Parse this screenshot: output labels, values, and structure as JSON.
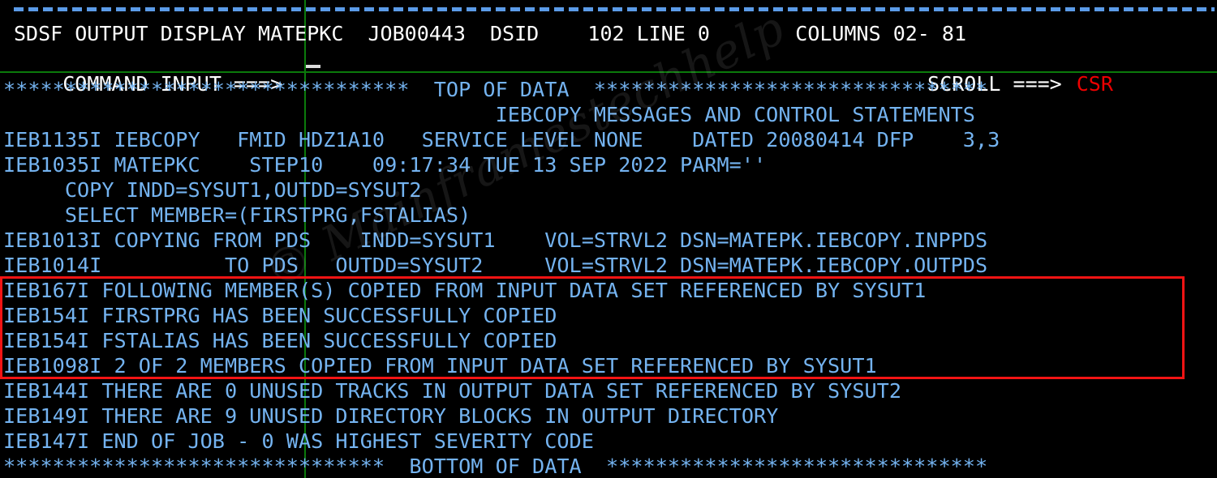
{
  "terminal": {
    "title": "SDSF OUTPUT DISPLAY",
    "background_color": "#000000",
    "header_text_color": "#ffffff",
    "body_text_color": "#74b3f0",
    "accent_red": "#ee0000",
    "highlight_box_color": "#f21414",
    "raster_line_color": "#0b7a0b",
    "dash_rule_color": "#5b9be8"
  },
  "watermark": {
    "text": "© Mainframestechhelp"
  },
  "header": {
    "line1": "SDSF OUTPUT DISPLAY MATEPKC  JOB00443  DSID    102 LINE 0       COLUMNS 02- 81",
    "line2_label": "COMMAND INPUT ===>",
    "line2_value": "",
    "scroll_label": "SCROLL ===>",
    "scroll_value": "CSR",
    "fields": {
      "panel": "SDSF OUTPUT DISPLAY",
      "jobname": "MATEPKC",
      "jobid": "JOB00443",
      "dsid_label": "DSID",
      "dsid": "102",
      "line_label": "LINE",
      "line": "0",
      "columns_label": "COLUMNS",
      "columns": "02- 81"
    }
  },
  "rows": [
    {
      "id": "top-of-data",
      "text": "*********************************  TOP OF DATA  ********************************"
    },
    {
      "id": "subtitle",
      "text": "                                        IEBCOPY MESSAGES AND CONTROL STATEMENTS"
    },
    {
      "id": "ieb1135i",
      "text": "IEB1135I IEBCOPY   FMID HDZ1A10   SERVICE LEVEL NONE    DATED 20080414 DFP    3,3"
    },
    {
      "id": "ieb1035i",
      "text": "IEB1035I MATEPKC    STEP10    09:17:34 TUE 13 SEP 2022 PARM=''"
    },
    {
      "id": "copy-stmt",
      "text": "     COPY INDD=SYSUT1,OUTDD=SYSUT2"
    },
    {
      "id": "select-stmt",
      "text": "     SELECT MEMBER=(FIRSTPRG,FSTALIAS)"
    },
    {
      "id": "ieb1013i",
      "text": "IEB1013I COPYING FROM PDS    INDD=SYSUT1    VOL=STRVL2 DSN=MATEPK.IEBCOPY.INPPDS"
    },
    {
      "id": "ieb1014i",
      "text": "IEB1014I          TO PDS   OUTDD=SYSUT2     VOL=STRVL2 DSN=MATEPK.IEBCOPY.OUTPDS"
    },
    {
      "id": "ieb167i",
      "text": "IEB167I FOLLOWING MEMBER(S) COPIED FROM INPUT DATA SET REFERENCED BY SYSUT1"
    },
    {
      "id": "ieb154i-a",
      "text": "IEB154I FIRSTPRG HAS BEEN SUCCESSFULLY COPIED"
    },
    {
      "id": "ieb154i-b",
      "text": "IEB154I FSTALIAS HAS BEEN SUCCESSFULLY COPIED"
    },
    {
      "id": "ieb1098i",
      "text": "IEB1098I 2 OF 2 MEMBERS COPIED FROM INPUT DATA SET REFERENCED BY SYSUT1"
    },
    {
      "id": "ieb144i",
      "text": "IEB144I THERE ARE 0 UNUSED TRACKS IN OUTPUT DATA SET REFERENCED BY SYSUT2"
    },
    {
      "id": "ieb149i",
      "text": "IEB149I THERE ARE 9 UNUSED DIRECTORY BLOCKS IN OUTPUT DIRECTORY"
    },
    {
      "id": "ieb147i",
      "text": "IEB147I END OF JOB - 0 WAS HIGHEST SEVERITY CODE"
    },
    {
      "id": "bottom-of-data",
      "text": "*******************************  BOTTOM OF DATA  *******************************"
    }
  ]
}
